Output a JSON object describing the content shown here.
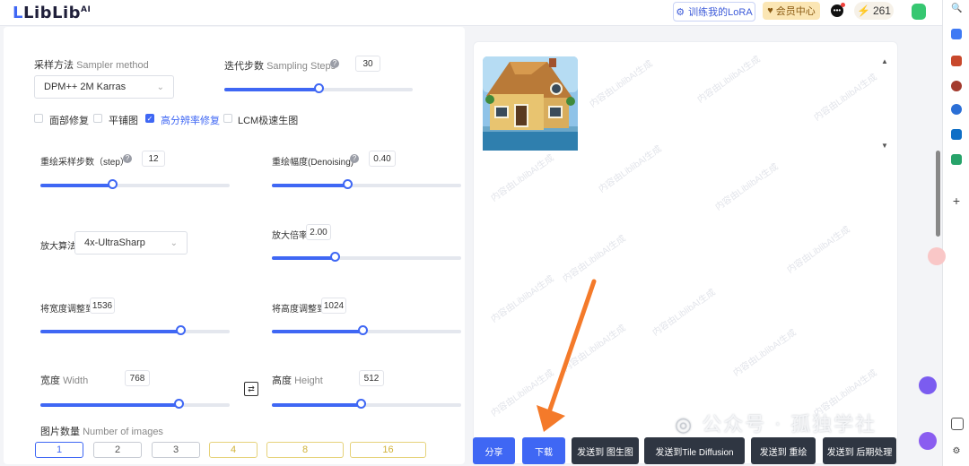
{
  "header": {
    "logo": "LibLib",
    "logo_sup": "AI",
    "lora_button": "训练我的LoRA",
    "vip_button": "会员中心",
    "credits": "261",
    "icons": [
      "lora-icon",
      "vip-icon",
      "chat-icon",
      "lightning-icon"
    ]
  },
  "left": {
    "sampler": {
      "label": "采样方法",
      "label_en": "Sampler method",
      "value": "DPM++ 2M Karras"
    },
    "steps": {
      "label": "迭代步数",
      "label_en": "Sampling Steps",
      "value": "30",
      "level": 0.5
    },
    "checks": [
      {
        "label": "面部修复",
        "checked": false
      },
      {
        "label": "平铺图",
        "checked": false
      },
      {
        "label": "高分辨率修复",
        "checked": true
      },
      {
        "label": "LCM极速生图",
        "checked": false
      }
    ],
    "hires_steps": {
      "label": "重绘采样步数（step）",
      "value": "12",
      "level": 0.38
    },
    "denoising": {
      "label": "重绘幅度(Denoising)",
      "value": "0.40",
      "level": 0.4
    },
    "upscaler": {
      "label": "放大算法",
      "value": "4x-UltraSharp"
    },
    "scale": {
      "label": "放大倍率",
      "value": "2.00",
      "level": 0.33
    },
    "resize_w": {
      "label": "将宽度调整到",
      "value": "1536",
      "level": 0.74
    },
    "resize_h": {
      "label": "将高度调整到",
      "value": "1024",
      "level": 0.48
    },
    "width": {
      "label": "宽度",
      "label_en": "Width",
      "value": "768",
      "level": 0.73
    },
    "height": {
      "label": "高度",
      "label_en": "Height",
      "value": "512",
      "level": 0.47
    },
    "count": {
      "label": "图片数量",
      "label_en": "Number of images",
      "options": [
        "1",
        "2",
        "3",
        "4",
        "8",
        "16"
      ],
      "selected": "1"
    }
  },
  "right": {
    "watermark": "内容由LiblibAI生成",
    "actions": [
      "分享",
      "下载",
      "发送到 图生图",
      "发送到Tile Diffusion",
      "发送到 重绘",
      "发送到 后期处理"
    ],
    "brand_watermark": "公众号 · 孤独学社"
  },
  "colors": {
    "accent": "#3f67f4",
    "arrow": "#f47a2a",
    "dark_button": "#2f3642",
    "vip": "#fbe6b4"
  }
}
